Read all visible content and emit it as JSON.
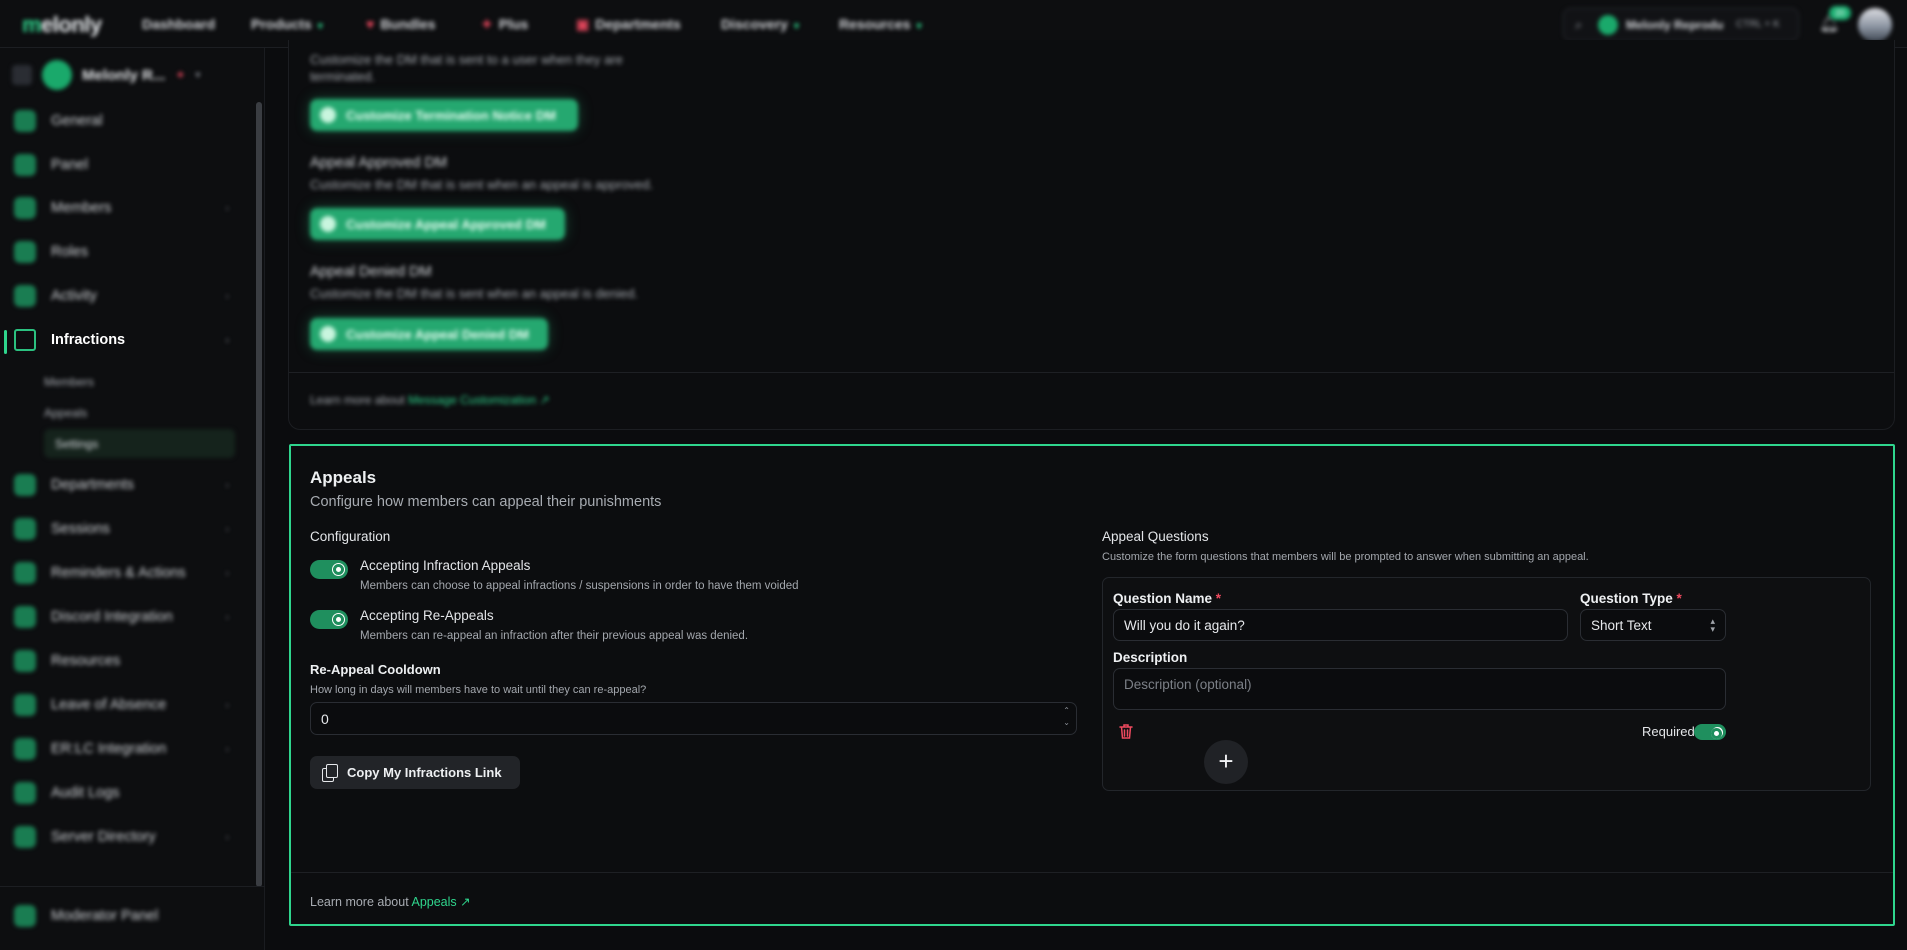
{
  "topnav": {
    "logo_mark": "m",
    "logo_rest": "elonly",
    "items": [
      {
        "label": "Dashboard",
        "dropdown": false,
        "icon": ""
      },
      {
        "label": "Products",
        "dropdown": true,
        "icon": ""
      },
      {
        "label": "Bundles",
        "dropdown": false,
        "icon": "heart-icon"
      },
      {
        "label": "Plus",
        "dropdown": false,
        "icon": "plus-star-icon"
      },
      {
        "label": "Departments",
        "dropdown": false,
        "icon": "department-icon"
      },
      {
        "label": "Discovery",
        "dropdown": true,
        "icon": ""
      },
      {
        "label": "Resources",
        "dropdown": true,
        "icon": ""
      }
    ],
    "search_server": "Melonly Reproduction",
    "search_shortcut": "CTRL + K",
    "notification_count": "20"
  },
  "sidebar": {
    "server_name": "Melonly R...",
    "items": [
      {
        "label": "General",
        "chevron": false
      },
      {
        "label": "Panel",
        "chevron": false
      },
      {
        "label": "Members",
        "chevron": true
      },
      {
        "label": "Roles",
        "chevron": false
      },
      {
        "label": "Activity",
        "chevron": true
      },
      {
        "label": "Infractions",
        "chevron": true,
        "active": true
      },
      {
        "label": "Departments",
        "chevron": true
      },
      {
        "label": "Sessions",
        "chevron": true
      },
      {
        "label": "Reminders & Actions",
        "chevron": true
      },
      {
        "label": "Discord Integration",
        "chevron": true
      },
      {
        "label": "Resources",
        "chevron": false
      },
      {
        "label": "Leave of Absence",
        "chevron": true
      },
      {
        "label": "ER:LC Integration",
        "chevron": true
      },
      {
        "label": "Audit Logs",
        "chevron": false
      },
      {
        "label": "Server Directory",
        "chevron": true
      }
    ],
    "subitems": [
      "Members",
      "Appeals",
      "Settings"
    ],
    "bottom_item": "Moderator Panel"
  },
  "upper": {
    "termination_desc_line1": "Customize the DM that is sent to a user when they are",
    "termination_desc_line2": "terminated.",
    "termination_button": "Customize Termination Notice DM",
    "approved_title": "Appeal Approved DM",
    "approved_desc": "Customize the DM that is sent when an appeal is approved.",
    "approved_button": "Customize Appeal Approved DM",
    "denied_title": "Appeal Denied DM",
    "denied_desc": "Customize the DM that is sent when an appeal is denied.",
    "denied_button": "Customize Appeal Denied DM",
    "learn_prefix": "Learn more about",
    "learn_link": "Message Customization"
  },
  "appeals": {
    "title": "Appeals",
    "subtitle": "Configure how members can appeal their punishments",
    "configuration_label": "Configuration",
    "options": [
      {
        "title": "Accepting Infraction Appeals",
        "desc": "Members can choose to appeal infractions / suspensions in order to have them voided",
        "enabled": true
      },
      {
        "title": "Accepting Re-Appeals",
        "desc": "Members can re-appeal an infraction after their previous appeal was denied.",
        "enabled": true
      }
    ],
    "cooldown_label": "Re-Appeal Cooldown",
    "cooldown_desc": "How long in days will members have to wait until they can re-appeal?",
    "cooldown_value": "0",
    "copy_button": "Copy My Infractions Link",
    "questions_label": "Appeal Questions",
    "questions_desc": "Customize the form questions that members will be prompted to answer when submitting an appeal.",
    "question": {
      "name_label": "Question Name",
      "name_value": "Will you do it again?",
      "type_label": "Question Type",
      "type_value": "Short Text",
      "description_label": "Description",
      "description_placeholder": "Description (optional)",
      "required_label": "Required",
      "required": true
    },
    "add_button": "+",
    "learn_prefix": "Learn more about",
    "learn_link": "Appeals"
  },
  "colors": {
    "accent": "#2fd58d",
    "danger": "#ef4a5f",
    "toggle_on": "#1f8f5e"
  }
}
